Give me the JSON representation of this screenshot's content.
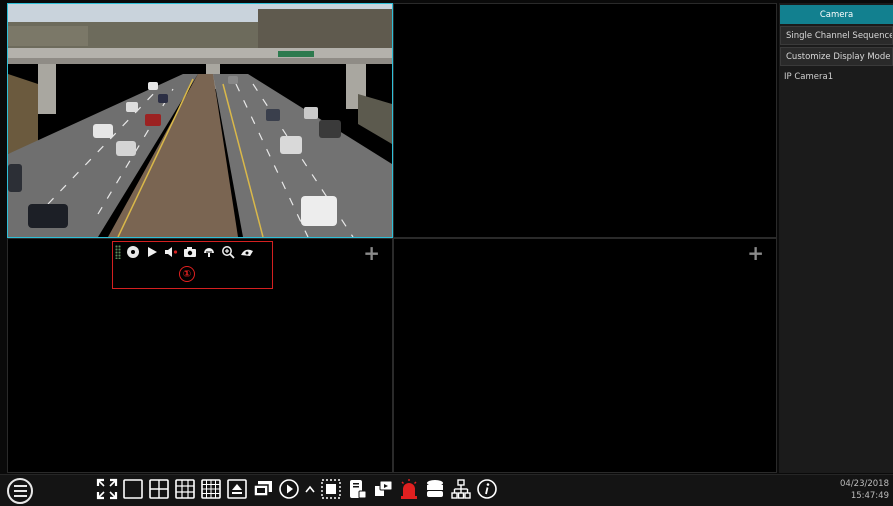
{
  "sidebar": {
    "tab_camera": "Camera",
    "single_channel_sequence": "Single Channel Sequence",
    "customize_display_mode": "Customize Display Mode",
    "camera_list": [
      "IP Camera1"
    ]
  },
  "camera_toolbar": {
    "callout_marker": "①",
    "icons": [
      "drag-handle-icon",
      "ptz-icon",
      "play-icon",
      "audio-icon",
      "snapshot-icon",
      "record-icon",
      "zoom-in-icon",
      "smart-detect-icon"
    ]
  },
  "tiles": {
    "add_symbol": "+"
  },
  "bottombar": {
    "date": "04/23/2018",
    "time": "15:47:49",
    "icons": [
      "start-menu-icon",
      "fullscreen-icon",
      "layout-1-icon",
      "layout-4-icon",
      "layout-9-icon",
      "layout-16-icon",
      "layout-custom-icon",
      "sequence-icon",
      "play-icon",
      "expand-up-icon",
      "crop-icon",
      "disk-icon",
      "manual-record-icon",
      "alarm-icon",
      "storage-icon",
      "network-icon",
      "info-icon"
    ]
  },
  "colors": {
    "accent": "#12808f",
    "selected_tile_border": "#2fc0d8",
    "callout_red": "#d42020",
    "alarm_red": "#e02020"
  }
}
